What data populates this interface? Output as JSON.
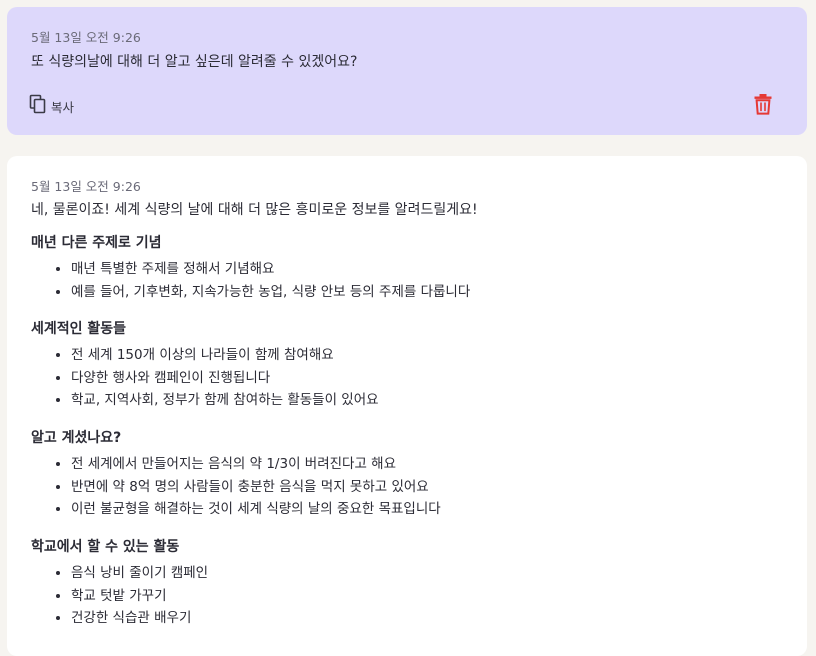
{
  "user_message": {
    "timestamp": "5월 13일 오전 9:26",
    "text": "또 식량의날에 대해 더 알고 싶은데 알려줄 수 있겠어요?",
    "copy_label": "복사",
    "icons": {
      "copy": "copy-icon",
      "delete": "trash-icon"
    },
    "colors": {
      "background": "#ddd8fb",
      "delete": "#e53935"
    }
  },
  "assistant_message": {
    "timestamp": "5월 13일 오전 9:26",
    "intro": "네, 물론이죠! 세계 식량의 날에 대해 더 많은 흥미로운 정보를 알려드릴게요!",
    "sections": [
      {
        "heading": "매년 다른 주제로 기념",
        "items": [
          "매년 특별한 주제를 정해서 기념해요",
          "예를 들어, 기후변화, 지속가능한 농업, 식량 안보 등의 주제를 다룹니다"
        ]
      },
      {
        "heading": "세계적인 활동들",
        "items": [
          "전 세계 150개 이상의 나라들이 함께 참여해요",
          "다양한 행사와 캠페인이 진행됩니다",
          "학교, 지역사회, 정부가 함께 참여하는 활동들이 있어요"
        ]
      },
      {
        "heading": "알고 계셨나요?",
        "items": [
          "전 세계에서 만들어지는 음식의 약 1/3이 버려진다고 해요",
          "반면에 약 8억 명의 사람들이 충분한 음식을 먹지 못하고 있어요",
          "이런 불균형을 해결하는 것이 세계 식량의 날의 중요한 목표입니다"
        ]
      },
      {
        "heading": "학교에서 할 수 있는 활동",
        "items": [
          "음식 낭비 줄이기 캠페인",
          "학교 텃밭 가꾸기",
          "건강한 식습관 배우기"
        ]
      }
    ]
  }
}
